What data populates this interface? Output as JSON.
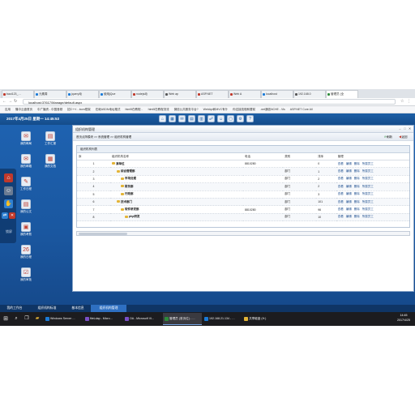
{
  "browser": {
    "tabs": [
      {
        "label": "baoi123_…",
        "color": "#c0392b"
      },
      {
        "label": "元素周",
        "color": "#1b7bd8"
      },
      {
        "label": "jquery动",
        "color": "#1b7bd8"
      },
      {
        "label": "使用jQue",
        "color": "#1b7bd8"
      },
      {
        "label": "nodejs动",
        "color": "#c0392b"
      },
      {
        "label": "Web ap",
        "color": "#555555"
      },
      {
        "label": "ASP.NET",
        "color": "#c0392b"
      },
      {
        "label": "Web A",
        "color": "#c0392b"
      },
      {
        "label": "localhost",
        "color": "#1b7bd8"
      },
      {
        "label": "192.168.0",
        "color": "#555555"
      },
      {
        "label": "管理员 (全",
        "color": "#2d8a3a",
        "active": true
      }
    ],
    "url": "localhost:37617/Manage/default.aspx",
    "bookmarks": [
      "应用",
      "隆中云盘首页",
      "中广播资 - 中国音频",
      "招C++/…born框架",
      "在继ASDN地址格式",
      "html5在教程 - ",
      "html5在教程流流",
      "微信公共服务平台?",
      "WebApi和MVC有什",
      "你这接技程和要前",
      ".net通信NCHE - Vis",
      "ASP.NET Core All"
    ]
  },
  "header": {
    "datetime": "2017年4月25日 星期一 14:45:53",
    "toolbar_icons": [
      "home-icon",
      "app-icon",
      "mail-icon",
      "folder-icon",
      "chart-icon",
      "network-icon",
      "user-icon",
      "window-icon",
      "settings-icon",
      "help-icon"
    ]
  },
  "desktop": {
    "icons": [
      {
        "label": "我的邮局",
        "name": "my-mail",
        "glyph": "✉"
      },
      {
        "label": "工作汇报",
        "name": "work-report",
        "glyph": "▤"
      },
      {
        "label": "我的邮箱",
        "name": "my-mailbox",
        "glyph": "✉"
      },
      {
        "label": "我的文档",
        "name": "my-docs",
        "glyph": "▦"
      },
      {
        "label": "工作日程",
        "name": "work-schedule",
        "glyph": "✎"
      },
      {
        "label": "我的公文",
        "name": "my-official-docs",
        "glyph": "▤"
      },
      {
        "label": "我的考勤",
        "name": "my-attendance",
        "glyph": "▣"
      },
      {
        "label": "我的日程",
        "name": "my-calendar",
        "glyph": "26"
      },
      {
        "label": "我的审批",
        "name": "my-approval",
        "glyph": "☑"
      }
    ],
    "dock": {
      "lock_label": "锁屏"
    }
  },
  "window": {
    "title": "组织机构管理",
    "breadcrumb": "首页点阵模块 >> 系统管理 >> 组织机构管理",
    "refresh_label": "刷新",
    "back_label": "返回",
    "panel_title": "组织机构列表",
    "columns": [
      "序",
      "组织机构名称",
      "电话",
      "类别",
      "排序",
      "管理"
    ],
    "rows": [
      {
        "seq": "1",
        "indent": 0,
        "name": "演单位",
        "phone": "8810280",
        "type": "",
        "sort": "0",
        "ops": [
          "查看",
          "编辑",
          "删除",
          "所属员工"
        ]
      },
      {
        "seq": "2",
        "indent": 1,
        "name": "综合管理部",
        "phone": "",
        "type": "部门",
        "sort": "1",
        "ops": [
          "查看",
          "编辑",
          "删除",
          "所属员工"
        ]
      },
      {
        "seq": "3",
        "indent": 2,
        "name": "市场处理",
        "phone": "",
        "type": "部门",
        "sort": "2",
        "ops": [
          "查看",
          "编辑",
          "删除",
          "所属员工"
        ]
      },
      {
        "seq": "4",
        "indent": 2,
        "name": "财务部",
        "phone": "",
        "type": "部门",
        "sort": "2",
        "ops": [
          "查看",
          "编辑",
          "删除",
          "所属员工"
        ]
      },
      {
        "seq": "5",
        "indent": 2,
        "name": "行政部",
        "phone": "",
        "type": "部门",
        "sort": "3",
        "ops": [
          "查看",
          "编辑",
          "删除",
          "所属员工"
        ]
      },
      {
        "seq": "6",
        "indent": 1,
        "name": "技术部门",
        "phone": "",
        "type": "部门",
        "sort": "101",
        "ops": [
          "查看",
          "编辑",
          "删除",
          "所属员工"
        ]
      },
      {
        "seq": "7",
        "indent": 2,
        "name": "软件研发部",
        "phone": "8810280",
        "type": "部门",
        "sort": "96",
        "ops": [
          "查看",
          "编辑",
          "删除",
          "所属员工"
        ]
      },
      {
        "seq": "8",
        "indent": 3,
        "name": "php研发",
        "phone": "",
        "type": "部门",
        "sort": "10",
        "ops": [
          "查看",
          "编辑",
          "删除",
          "所属员工"
        ]
      }
    ]
  },
  "footer_tabs": [
    "我的工作台",
    "组织机构标准",
    "基本信息",
    "组织机构管理"
  ],
  "taskbar": {
    "items": [
      {
        "label": "Windows Server …",
        "color": "#1b7bd8"
      },
      {
        "label": "fileLdap - Micro…",
        "color": "#7b4fc6"
      },
      {
        "label": "OA - Microsoft Vi…",
        "color": "#7b4fc6"
      },
      {
        "label": "管理员 (首页位) - …",
        "color": "#2d8a3a",
        "active": true
      },
      {
        "label": "192.168.21.134 - …",
        "color": "#1b7bd8"
      },
      {
        "label": "共享磁盘 (H:)",
        "color": "#e3b437"
      }
    ],
    "time": "14:45",
    "date": "2017/4/25"
  }
}
